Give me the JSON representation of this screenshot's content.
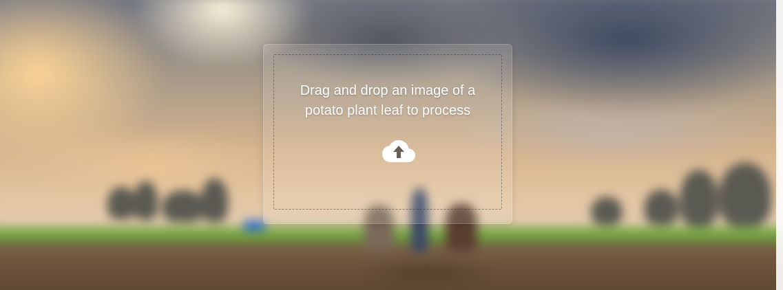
{
  "dropzone": {
    "prompt_line1": "Drag and drop an image of a",
    "prompt_line2": "potato plant leaf to process",
    "icon": "cloud-upload-icon"
  },
  "colors": {
    "text": "#ffffff",
    "icon": "#ffffff"
  }
}
